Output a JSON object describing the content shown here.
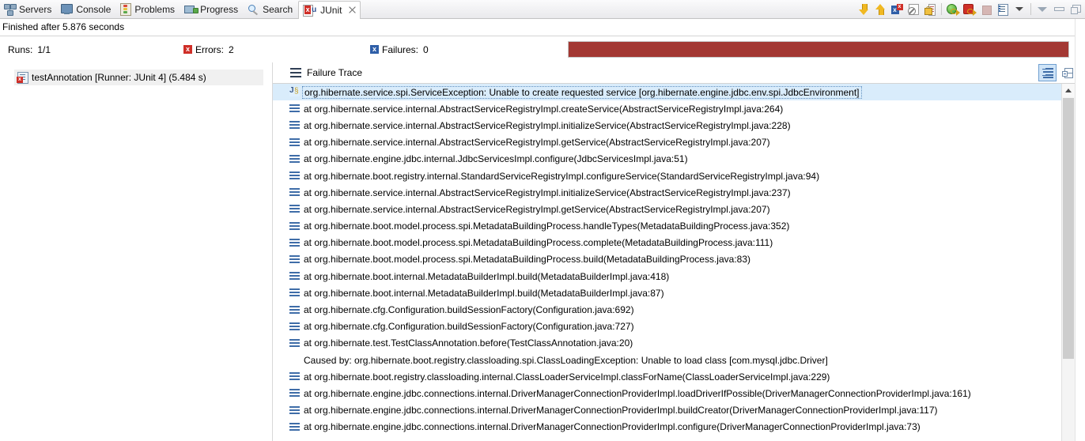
{
  "window": {
    "tabs": [
      {
        "label": "Servers",
        "icon": "servers-icon",
        "active": false
      },
      {
        "label": "Console",
        "icon": "console-icon",
        "active": false
      },
      {
        "label": "Problems",
        "icon": "problems-icon",
        "active": false
      },
      {
        "label": "Progress",
        "icon": "progress-icon",
        "active": false
      },
      {
        "label": "Search",
        "icon": "search-icon",
        "active": false
      },
      {
        "label": "JUnit",
        "icon": "junit-icon",
        "active": true
      }
    ],
    "toolbar": [
      {
        "name": "next-failure-button",
        "icon": "arrow-down-icon",
        "tooltip": "Next Failed Test"
      },
      {
        "name": "previous-failure-button",
        "icon": "arrow-up-icon",
        "tooltip": "Previous Failed Test"
      },
      {
        "name": "show-failures-only-button",
        "icon": "failures-only-icon",
        "tooltip": "Show Failures Only"
      },
      {
        "name": "scroll-lock-button",
        "icon": "no-scroll-icon",
        "tooltip": "Scroll Lock"
      },
      {
        "name": "pin-test-run-button",
        "icon": "lock-icon",
        "tooltip": "Pin this Test Run"
      },
      {
        "name": "rerun-test-button",
        "icon": "rerun-icon",
        "tooltip": "Rerun Test"
      },
      {
        "name": "rerun-failed-button",
        "icon": "rerun-failed-icon",
        "tooltip": "Rerun Test - Failures First"
      },
      {
        "name": "stop-button",
        "icon": "stop-icon",
        "tooltip": "Stop JUnit Test Run"
      },
      {
        "name": "test-run-history-button",
        "icon": "history-icon",
        "tooltip": "Test Run History"
      },
      {
        "name": "history-dropdown-button",
        "icon": "chevron-down-icon",
        "tooltip": "Test Run History Menu"
      },
      {
        "name": "view-menu-button",
        "icon": "view-menu-icon",
        "tooltip": "View Menu"
      },
      {
        "name": "minimize-button",
        "icon": "minimize-icon",
        "tooltip": "Minimize"
      },
      {
        "name": "maximize-button",
        "icon": "maximize-icon",
        "tooltip": "Maximize"
      }
    ]
  },
  "status": {
    "text": "Finished after 5.876 seconds"
  },
  "counters": {
    "runs_label": "Runs:",
    "runs_value": "1/1",
    "errors_label": "Errors:",
    "errors_value": "2",
    "errors_icon": "error-box-icon",
    "failures_label": "Failures:",
    "failures_value": "0",
    "failures_icon": "failure-box-icon",
    "progress_percent": 100,
    "progress_color": "#a33833"
  },
  "test_tree": {
    "items": [
      {
        "label": "testAnnotation [Runner: JUnit 4] (5.484 s)",
        "icon": "test-failed-icon",
        "selected": true
      }
    ]
  },
  "failure_trace": {
    "title": "Failure Trace",
    "header_icon": "stack-trace-icon",
    "tools": [
      {
        "name": "filter-stack-trace-button",
        "icon": "collapse-stack-icon",
        "selected": true
      },
      {
        "name": "expand-stack-button",
        "icon": "expand-all-icon",
        "selected": false
      }
    ],
    "rows": [
      {
        "icon": "exception-icon",
        "text": "org.hibernate.service.spi.ServiceException: Unable to create requested service [org.hibernate.engine.jdbc.env.spi.JdbcEnvironment]",
        "selected": true
      },
      {
        "icon": "stack-frame-icon",
        "text": "at org.hibernate.service.internal.AbstractServiceRegistryImpl.createService(AbstractServiceRegistryImpl.java:264)",
        "selected": false
      },
      {
        "icon": "stack-frame-icon",
        "text": "at org.hibernate.service.internal.AbstractServiceRegistryImpl.initializeService(AbstractServiceRegistryImpl.java:228)",
        "selected": false
      },
      {
        "icon": "stack-frame-icon",
        "text": "at org.hibernate.service.internal.AbstractServiceRegistryImpl.getService(AbstractServiceRegistryImpl.java:207)",
        "selected": false
      },
      {
        "icon": "stack-frame-icon",
        "text": "at org.hibernate.engine.jdbc.internal.JdbcServicesImpl.configure(JdbcServicesImpl.java:51)",
        "selected": false
      },
      {
        "icon": "stack-frame-icon",
        "text": "at org.hibernate.boot.registry.internal.StandardServiceRegistryImpl.configureService(StandardServiceRegistryImpl.java:94)",
        "selected": false
      },
      {
        "icon": "stack-frame-icon",
        "text": "at org.hibernate.service.internal.AbstractServiceRegistryImpl.initializeService(AbstractServiceRegistryImpl.java:237)",
        "selected": false
      },
      {
        "icon": "stack-frame-icon",
        "text": "at org.hibernate.service.internal.AbstractServiceRegistryImpl.getService(AbstractServiceRegistryImpl.java:207)",
        "selected": false
      },
      {
        "icon": "stack-frame-icon",
        "text": "at org.hibernate.boot.model.process.spi.MetadataBuildingProcess.handleTypes(MetadataBuildingProcess.java:352)",
        "selected": false
      },
      {
        "icon": "stack-frame-icon",
        "text": "at org.hibernate.boot.model.process.spi.MetadataBuildingProcess.complete(MetadataBuildingProcess.java:111)",
        "selected": false
      },
      {
        "icon": "stack-frame-icon",
        "text": "at org.hibernate.boot.model.process.spi.MetadataBuildingProcess.build(MetadataBuildingProcess.java:83)",
        "selected": false
      },
      {
        "icon": "stack-frame-icon",
        "text": "at org.hibernate.boot.internal.MetadataBuilderImpl.build(MetadataBuilderImpl.java:418)",
        "selected": false
      },
      {
        "icon": "stack-frame-icon",
        "text": "at org.hibernate.boot.internal.MetadataBuilderImpl.build(MetadataBuilderImpl.java:87)",
        "selected": false
      },
      {
        "icon": "stack-frame-icon",
        "text": "at org.hibernate.cfg.Configuration.buildSessionFactory(Configuration.java:692)",
        "selected": false
      },
      {
        "icon": "stack-frame-icon",
        "text": "at org.hibernate.cfg.Configuration.buildSessionFactory(Configuration.java:727)",
        "selected": false
      },
      {
        "icon": "stack-frame-icon",
        "text": "at org.hibernate.test.TestClassAnnotation.before(TestClassAnnotation.java:20)",
        "selected": false
      },
      {
        "icon": "none",
        "text": "Caused by: org.hibernate.boot.registry.classloading.spi.ClassLoadingException: Unable to load class [com.mysql.jdbc.Driver]",
        "selected": false
      },
      {
        "icon": "stack-frame-icon",
        "text": "at org.hibernate.boot.registry.classloading.internal.ClassLoaderServiceImpl.classForName(ClassLoaderServiceImpl.java:229)",
        "selected": false
      },
      {
        "icon": "stack-frame-icon",
        "text": "at org.hibernate.engine.jdbc.connections.internal.DriverManagerConnectionProviderImpl.loadDriverIfPossible(DriverManagerConnectionProviderImpl.java:161)",
        "selected": false
      },
      {
        "icon": "stack-frame-icon",
        "text": "at org.hibernate.engine.jdbc.connections.internal.DriverManagerConnectionProviderImpl.buildCreator(DriverManagerConnectionProviderImpl.java:117)",
        "selected": false
      },
      {
        "icon": "stack-frame-icon",
        "text": "at org.hibernate.engine.jdbc.connections.internal.DriverManagerConnectionProviderImpl.configure(DriverManagerConnectionProviderImpl.java:73)",
        "selected": false
      }
    ]
  }
}
